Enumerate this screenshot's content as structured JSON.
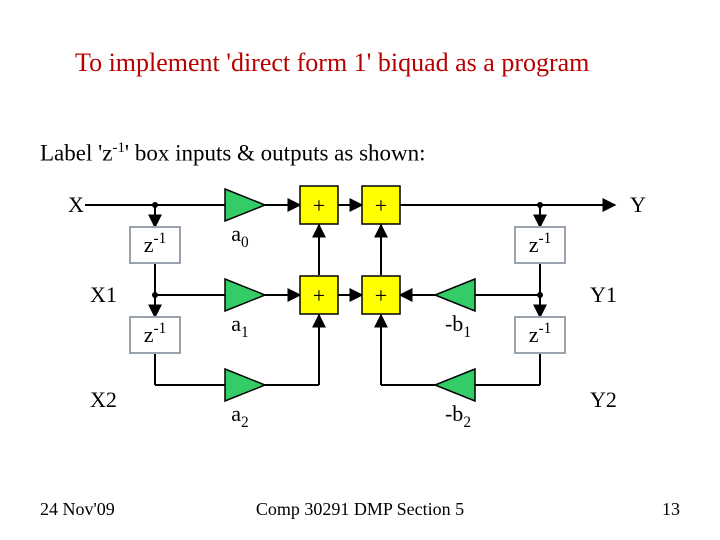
{
  "title": "To implement 'direct form 1' biquad as a program",
  "subtitle_html": "Label 'z<sup>-1</sup>' box inputs & outputs as shown:",
  "diagram": {
    "input": "X",
    "output": "Y",
    "tap_x1": "X1",
    "tap_x2": "X2",
    "tap_y1": "Y1",
    "tap_y2": "Y2",
    "delay_label_base": "z",
    "delay_label_exp": "-1",
    "coeff_a0": "a",
    "coeff_a0_sub": "0",
    "coeff_a1": "a",
    "coeff_a1_sub": "1",
    "coeff_a2": "a",
    "coeff_a2_sub": "2",
    "coeff_b1": "-b",
    "coeff_b1_sub": "1",
    "coeff_b2": "-b",
    "coeff_b2_sub": "2",
    "plus": "+"
  },
  "footer": {
    "left": "24 Nov'09",
    "center": "Comp 30291 DMP Section 5",
    "right": "13"
  },
  "colors": {
    "title": "#b80000",
    "box": "#bfc7d0",
    "box_fill": "#ffffff",
    "amp_fill": "#33cc66",
    "sum_fill": "#ffff00",
    "stroke": "#000000"
  }
}
